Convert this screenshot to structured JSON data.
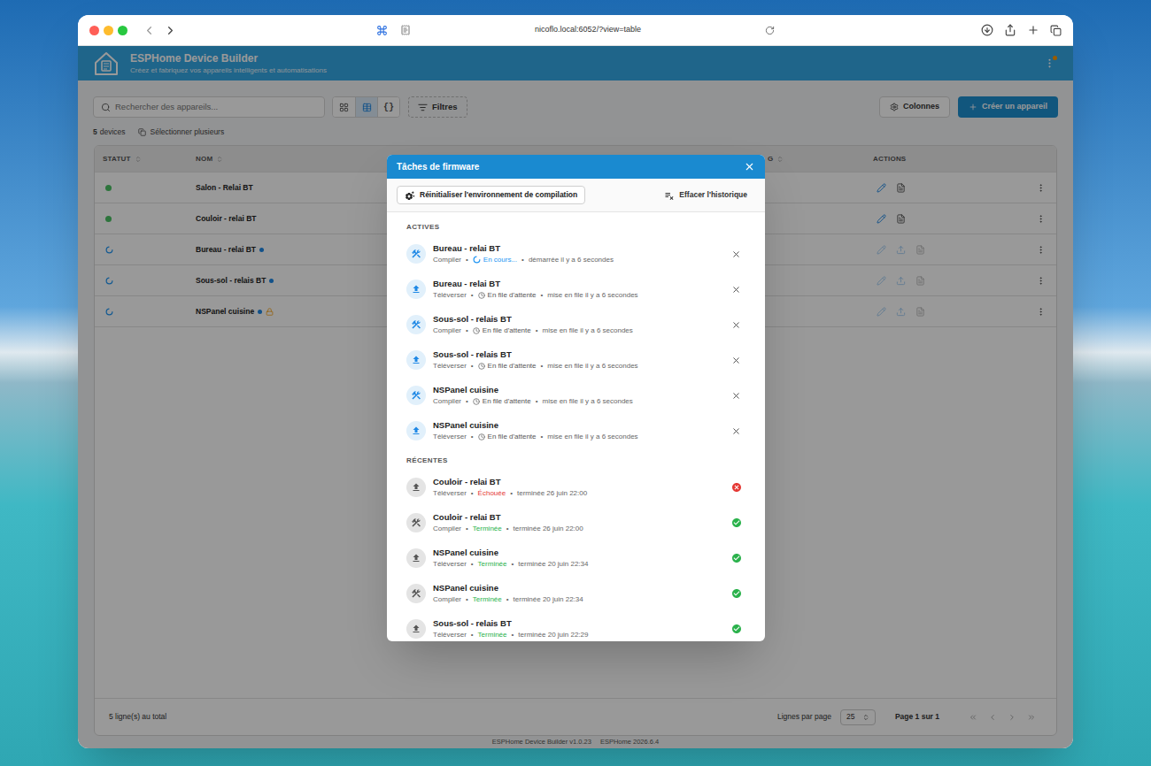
{
  "browser": {
    "url": "nicoflo.local:6052/?view=table"
  },
  "header": {
    "title": "ESPHome Device Builder",
    "subtitle": "Créez et fabriquez vos appareils intelligents et automatisations",
    "menu_notification": true
  },
  "toolbar": {
    "search_placeholder": "Rechercher des appareils...",
    "views": [
      {
        "kind": "grid",
        "label": "",
        "selected": false
      },
      {
        "kind": "table",
        "label": "",
        "selected": true
      },
      {
        "kind": "code",
        "label": "{}",
        "selected": false
      }
    ],
    "filters": "Filtres",
    "columns": "Colonnes",
    "create": "Créer un appareil"
  },
  "summary": {
    "count": "5",
    "count_label": "devices",
    "select_multiple": "Sélectionner plusieurs"
  },
  "table": {
    "columns": [
      {
        "label": "STATUT",
        "sortable": true
      },
      {
        "label": "NOM",
        "sortable": true
      },
      {
        "label": "G",
        "sortable": true
      },
      {
        "label": "ACTIONS",
        "sortable": false
      }
    ],
    "rows": [
      {
        "name": "Salon - Relai BT",
        "status": "online",
        "color": "#4cc264",
        "update_available": false,
        "locked": false,
        "upload_action": false,
        "actions_disabled": false
      },
      {
        "name": "Couloir - relai BT",
        "status": "online",
        "color": "#4cc264",
        "update_available": false,
        "locked": false,
        "upload_action": false,
        "actions_disabled": false
      },
      {
        "name": "Bureau - relai BT",
        "status": "busy",
        "color": "#2196f3",
        "update_available": true,
        "locked": false,
        "upload_action": true,
        "actions_disabled": true
      },
      {
        "name": "Sous-sol - relais BT",
        "status": "busy",
        "color": "#2196f3",
        "update_available": true,
        "locked": false,
        "upload_action": true,
        "actions_disabled": true
      },
      {
        "name": "NSPanel cuisine",
        "status": "busy",
        "color": "#2196f3",
        "update_available": true,
        "locked": true,
        "upload_action": true,
        "actions_disabled": true
      }
    ]
  },
  "footer": {
    "total": "5 ligne(s) au total",
    "rows_per_page_label": "Lignes par page",
    "rows_per_page": "25",
    "page": "Page 1 sur 1"
  },
  "version": {
    "builder": "ESPHome Device Builder v1.0.23",
    "esphome": "ESPHome 2026.6.4"
  },
  "dialog": {
    "title": "Tâches de firmware",
    "reset_button": "Réinitialiser l'environnement de compilation",
    "clear_button": "Effacer l'historique",
    "separator": "•",
    "sections": [
      {
        "title": "ACTIVES",
        "kind": "active",
        "tasks": [
          {
            "device": "Bureau - relai BT",
            "kind": "compile",
            "type": "Compiler",
            "state": "running",
            "status": "En cours...",
            "time": "démarrée il y a 6 secondes",
            "color": "#2196f3"
          },
          {
            "device": "Bureau - relai BT",
            "kind": "upload",
            "type": "Téléverser",
            "state": "queued",
            "status": "En file d'attente",
            "time": "mise en file il y a 6 secondes",
            "color": "#555555"
          },
          {
            "device": "Sous-sol - relais BT",
            "kind": "compile",
            "type": "Compiler",
            "state": "queued",
            "status": "En file d'attente",
            "time": "mise en file il y a 6 secondes",
            "color": "#555555"
          },
          {
            "device": "Sous-sol - relais BT",
            "kind": "upload",
            "type": "Téléverser",
            "state": "queued",
            "status": "En file d'attente",
            "time": "mise en file il y a 6 secondes",
            "color": "#555555"
          },
          {
            "device": "NSPanel cuisine",
            "kind": "compile",
            "type": "Compiler",
            "state": "queued",
            "status": "En file d'attente",
            "time": "mise en file il y a 6 secondes",
            "color": "#555555"
          },
          {
            "device": "NSPanel cuisine",
            "kind": "upload",
            "type": "Téléverser",
            "state": "queued",
            "status": "En file d'attente",
            "time": "mise en file il y a 6 secondes",
            "color": "#555555"
          }
        ]
      },
      {
        "title": "RÉCENTES",
        "kind": "recent",
        "tasks": [
          {
            "device": "Couloir - relai BT",
            "kind": "upload",
            "type": "Téléverser",
            "state": "failed",
            "status": "Échouée",
            "time": "terminée 26 juin 22:00",
            "color": "#e53935"
          },
          {
            "device": "Couloir - relai BT",
            "kind": "compile",
            "type": "Compiler",
            "state": "done",
            "status": "Terminée",
            "time": "terminée 26 juin 22:00",
            "color": "#2bb24c"
          },
          {
            "device": "NSPanel cuisine",
            "kind": "upload",
            "type": "Téléverser",
            "state": "done",
            "status": "Terminée",
            "time": "terminée 20 juin 22:34",
            "color": "#2bb24c"
          },
          {
            "device": "NSPanel cuisine",
            "kind": "compile",
            "type": "Compiler",
            "state": "done",
            "status": "Terminée",
            "time": "terminée 20 juin 22:34",
            "color": "#2bb24c"
          },
          {
            "device": "Sous-sol - relais BT",
            "kind": "upload",
            "type": "Téléverser",
            "state": "done",
            "status": "Terminée",
            "time": "terminée 20 juin 22:29",
            "color": "#2bb24c"
          }
        ]
      }
    ]
  }
}
